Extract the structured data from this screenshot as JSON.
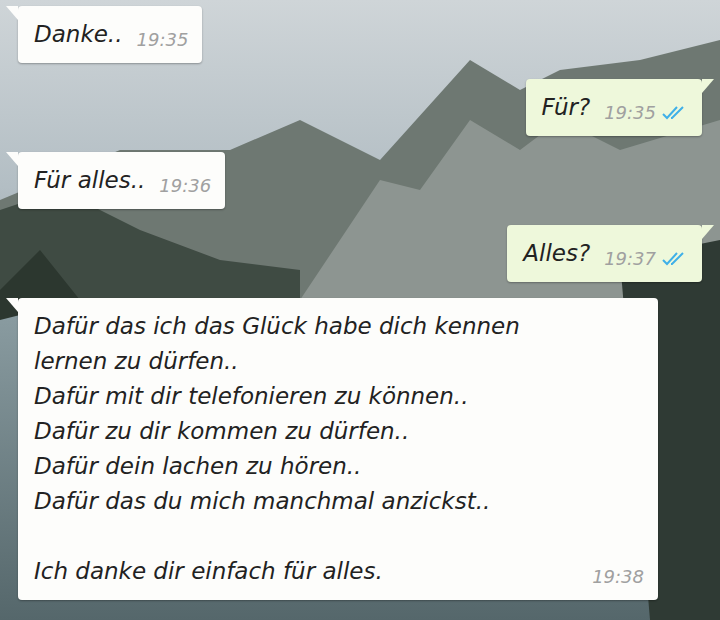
{
  "chat": {
    "messages": [
      {
        "kind": "incoming",
        "text": "Danke..",
        "time": "19:35"
      },
      {
        "kind": "outgoing",
        "text": "Für?",
        "time": "19:35",
        "read": true
      },
      {
        "kind": "incoming",
        "text": "Für alles..",
        "time": "19:36"
      },
      {
        "kind": "outgoing",
        "text": "Alles?",
        "time": "19:37",
        "read": true
      },
      {
        "kind": "incoming",
        "text": "Dafür das ich das Glück habe dich kennen lernen zu dürfen..\nDafür mit dir telefonieren zu können..\nDafür zu dir kommen zu dürfen..\nDafür dein lachen zu hören..\nDafür das du mich manchmal anzickst..\n\nIch danke dir einfach für alles.",
        "time": "19:38"
      }
    ]
  }
}
